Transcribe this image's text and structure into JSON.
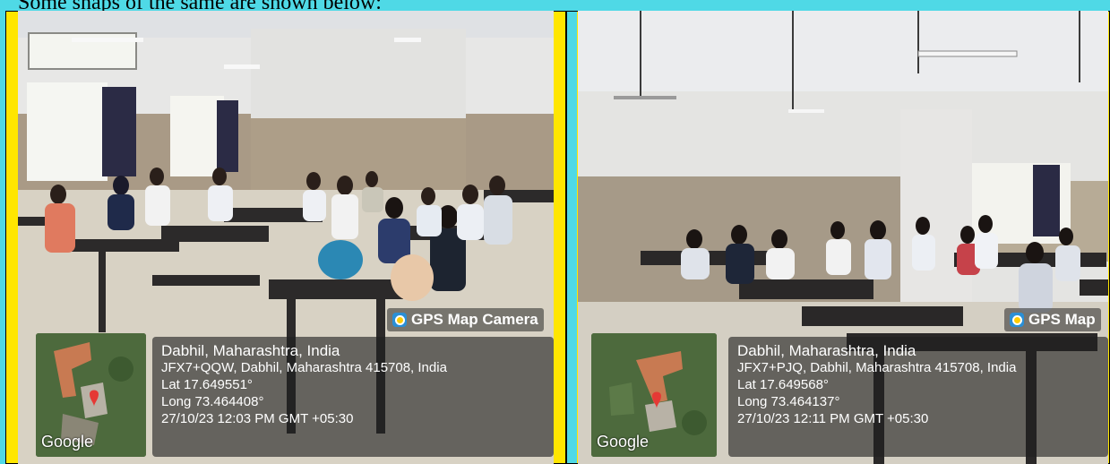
{
  "caption": "Some snaps of the same are shown below:",
  "photos": [
    {
      "stamp_title": "GPS Map Camera",
      "place": "Dabhil, Maharashtra, India",
      "address": "JFX7+QQW, Dabhil, Maharashtra 415708, India",
      "lat": "Lat 17.649551°",
      "long": "Long 73.464408°",
      "datetime": "27/10/23 12:03 PM GMT +05:30",
      "map_brand": "Google"
    },
    {
      "stamp_title": "GPS Map",
      "place": "Dabhil, Maharashtra, India",
      "address": "JFX7+PJQ, Dabhil, Maharashtra 415708, India",
      "lat": "Lat 17.649568°",
      "long": "Long 73.464137°",
      "datetime": "27/10/23 12:11 PM GMT +05:30",
      "map_brand": "Google"
    }
  ],
  "colors": {
    "frame_cyan": "#4fd9e6",
    "frame_yellow": "#ffe600",
    "map_pin": "#e53935"
  }
}
